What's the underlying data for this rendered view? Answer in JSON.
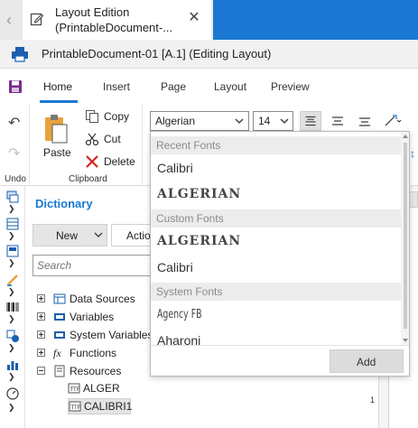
{
  "tab": {
    "title": "Layout Edition (PrintableDocument-..."
  },
  "document": {
    "title": "PrintableDocument-01 [A.1] (Editing Layout)"
  },
  "ribbon_tabs": [
    "Home",
    "Insert",
    "Page",
    "Layout",
    "Preview"
  ],
  "undo_group": {
    "label": "Undo"
  },
  "clipboard": {
    "paste": "Paste",
    "copy": "Copy",
    "cut": "Cut",
    "delete": "Delete",
    "label": "Clipboard"
  },
  "font": {
    "family": "Algerian",
    "size": "14"
  },
  "dictionary": {
    "title": "Dictionary",
    "new_label": "New",
    "action_label": "Actio",
    "search_placeholder": "Search",
    "tree": [
      "Data Sources",
      "Variables",
      "System Variables",
      "Functions",
      "Resources"
    ],
    "resources": [
      "ALGER",
      "CALIBRI1"
    ]
  },
  "ruler": {
    "number": "1"
  },
  "font_popup": {
    "recent_header": "Recent Fonts",
    "recent": [
      "Calibri",
      "ALGERIAN"
    ],
    "custom_header": "Custom Fonts",
    "custom": [
      "ALGERIAN",
      "Calibri"
    ],
    "system_header": "System Fonts",
    "system": [
      "Agency FB",
      "Aharoni"
    ],
    "add_label": "Add"
  },
  "colors": {
    "accent": "#1a78d2",
    "header_bg": "#ececec"
  }
}
